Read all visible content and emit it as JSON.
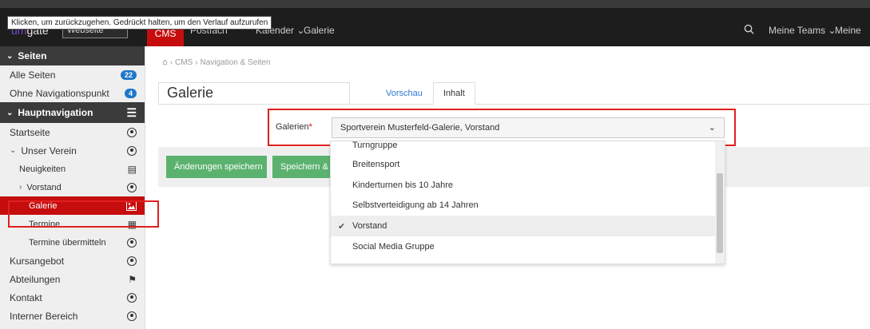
{
  "tooltip": "Klicken, um zurückzugehen. Gedrückt halten, um den Verlauf aufzurufen",
  "topbar": {
    "brand": "gate",
    "brand_accent": "um",
    "site_select": "Webseite",
    "cms_tab": "CMS",
    "nav_links": [
      "Postfach",
      "Kalender",
      "Galerie"
    ],
    "search_icon": "search-icon",
    "teams": "Meine Teams",
    "more": "Meine"
  },
  "sidebar": {
    "section_pages": "Seiten",
    "all_pages": {
      "label": "Alle Seiten",
      "count": "22"
    },
    "no_nav": {
      "label": "Ohne Navigationspunkt",
      "count": "4"
    },
    "section_main": "Hauptnavigation",
    "items": [
      {
        "label": "Startseite",
        "icon": "radio-icon",
        "level": 0
      },
      {
        "label": "Unser Verein",
        "icon": "radio-icon",
        "level": 0,
        "expanded": true
      },
      {
        "label": "Neuigkeiten",
        "icon": "news-icon",
        "level": 1
      },
      {
        "label": "Vorstand",
        "icon": "radio-icon",
        "level": 1,
        "collapsed": true
      },
      {
        "label": "Galerie",
        "icon": "image-icon",
        "level": 1,
        "active": true
      },
      {
        "label": "Termine",
        "icon": "calendar-icon",
        "level": 1
      },
      {
        "label": "Termine übermitteln",
        "icon": "radio-icon",
        "level": 1
      },
      {
        "label": "Kursangebot",
        "icon": "radio-icon",
        "level": 0
      },
      {
        "label": "Abteilungen",
        "icon": "flag-icon",
        "level": 0
      },
      {
        "label": "Kontakt",
        "icon": "radio-icon",
        "level": 0
      },
      {
        "label": "Interner Bereich",
        "icon": "radio-icon",
        "level": 0
      }
    ]
  },
  "breadcrumb": {
    "home_icon": "home-icon",
    "parts": [
      "CMS",
      "Navigation & Seiten"
    ]
  },
  "page_title": "Galerie",
  "tabs": [
    {
      "label": "Vorschau",
      "active": false
    },
    {
      "label": "Inhalt",
      "active": true
    }
  ],
  "form": {
    "label": "Galerien",
    "required_marker": "*",
    "selected_value": "Sportverein Musterfeld-Galerie, Vorstand"
  },
  "buttons": {
    "save": "Änderungen speichern",
    "save_and": "Speichern &"
  },
  "dropdown": {
    "options": [
      {
        "label": "Turngruppe",
        "selected": false
      },
      {
        "label": "Breitensport",
        "selected": false
      },
      {
        "label": "Kinderturnen bis 10 Jahre",
        "selected": false
      },
      {
        "label": "Selbstverteidigung ab 14 Jahren",
        "selected": false
      },
      {
        "label": "Vorstand",
        "selected": true
      },
      {
        "label": "Social Media Gruppe",
        "selected": false
      }
    ]
  },
  "colors": {
    "accent_red": "#c60d0d",
    "save_green": "#5bb26f",
    "badge_blue": "#1f77c8",
    "highlight": "#e0201f"
  }
}
